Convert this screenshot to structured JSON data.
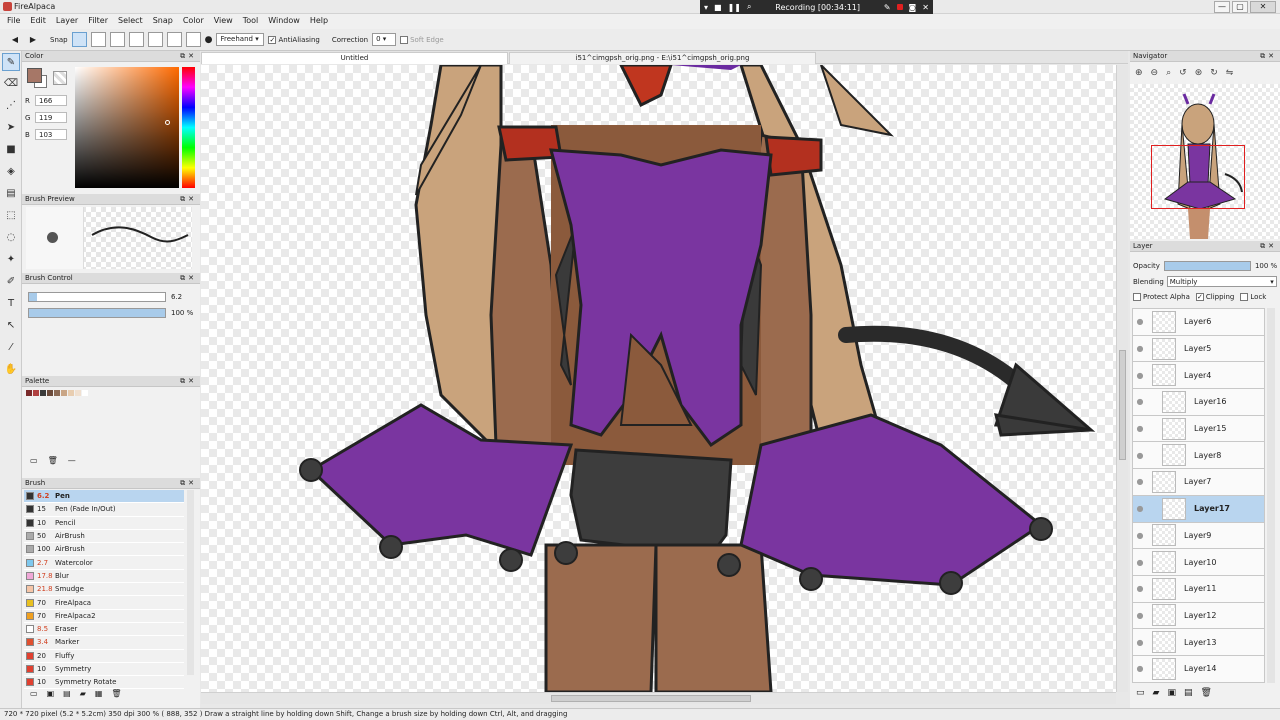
{
  "window": {
    "title": "FireAlpaca",
    "min": "—",
    "max": "▢",
    "close": "✕"
  },
  "recording": {
    "text": "Recording [00:34:11]"
  },
  "menu": [
    "File",
    "Edit",
    "Layer",
    "Filter",
    "Select",
    "Snap",
    "Color",
    "View",
    "Tool",
    "Window",
    "Help"
  ],
  "toolbar": {
    "snap_label": "Snap",
    "mode_select": "Freehand",
    "antialiasing_label": "AntiAliasing",
    "correction_label": "Correction",
    "correction_value": "0",
    "softedge_label": "Soft Edge"
  },
  "color_panel": {
    "title": "Color",
    "r_label": "R",
    "r": "166",
    "g_label": "G",
    "g": "119",
    "b_label": "B",
    "b": "103",
    "fg_color": "#a67767"
  },
  "brush_preview": {
    "title": "Brush Preview"
  },
  "brush_control": {
    "title": "Brush Control",
    "size": "6.2",
    "size_fill": 0.06,
    "opacity": "100 %",
    "opacity_fill": 1.0
  },
  "palette": {
    "title": "Palette",
    "colors": [
      "#7a2a2a",
      "#b04040",
      "#3a3a3a",
      "#6b4a3a",
      "#8b6a55",
      "#c9a585",
      "#e8cdb0",
      "#f0e0d0",
      "#ffffff"
    ]
  },
  "brush_panel": {
    "title": "Brush",
    "items": [
      {
        "size": "6.2",
        "name": "Pen",
        "color": "#333333",
        "selected": true
      },
      {
        "size": "15",
        "name": "Pen (Fade In/Out)",
        "color": "#333333"
      },
      {
        "size": "10",
        "name": "Pencil",
        "color": "#333333"
      },
      {
        "size": "50",
        "name": "AirBrush",
        "color": "#aaaaaa"
      },
      {
        "size": "100",
        "name": "AirBrush",
        "color": "#aaaaaa"
      },
      {
        "size": "2.7",
        "name": "Watercolor",
        "color": "#7ec8ee"
      },
      {
        "size": "17.8",
        "name": "Blur",
        "color": "#f0a8d8"
      },
      {
        "size": "21.8",
        "name": "Smudge",
        "color": "#f6c6a8"
      },
      {
        "size": "70",
        "name": "FireAlpaca",
        "color": "#e8c020"
      },
      {
        "size": "70",
        "name": "FireAlpaca2",
        "color": "#f0a020"
      },
      {
        "size": "8.5",
        "name": "Eraser",
        "color": "#ffffff"
      },
      {
        "size": "3.4",
        "name": "Marker",
        "color": "#e05030"
      },
      {
        "size": "20",
        "name": "Fluffy",
        "color": "#e04030"
      },
      {
        "size": "10",
        "name": "Symmetry",
        "color": "#e04030"
      },
      {
        "size": "10",
        "name": "Symmetry Rotate",
        "color": "#e04030"
      }
    ]
  },
  "tabs": [
    "Untitled",
    "i51^cimgpsh_orig.png - E:\\i51^cimgpsh_orig.png"
  ],
  "navigator": {
    "title": "Navigator"
  },
  "layer_panel": {
    "title": "Layer",
    "opacity_label": "Opacity",
    "opacity_value": "100 %",
    "blending_label": "Blending",
    "blending_value": "Multiply",
    "protect_alpha": "Protect Alpha",
    "clipping": "Clipping",
    "lock": "Lock",
    "layers": [
      {
        "name": "Layer6"
      },
      {
        "name": "Layer5"
      },
      {
        "name": "Layer4"
      },
      {
        "name": "Layer16",
        "indent": true
      },
      {
        "name": "Layer15",
        "indent": true
      },
      {
        "name": "Layer8",
        "indent": true
      },
      {
        "name": "Layer7"
      },
      {
        "name": "Layer17",
        "indent": true,
        "selected": true
      },
      {
        "name": "Layer9"
      },
      {
        "name": "Layer10"
      },
      {
        "name": "Layer11"
      },
      {
        "name": "Layer12"
      },
      {
        "name": "Layer13"
      },
      {
        "name": "Layer14"
      }
    ]
  },
  "status": {
    "text": "720 * 720 pixel  (5.2 * 5.2cm)  350 dpi  300 %  ( 888, 352 )  Draw a straight line by holding down Shift, Change a brush size by holding down Ctrl, Alt, and dragging"
  }
}
